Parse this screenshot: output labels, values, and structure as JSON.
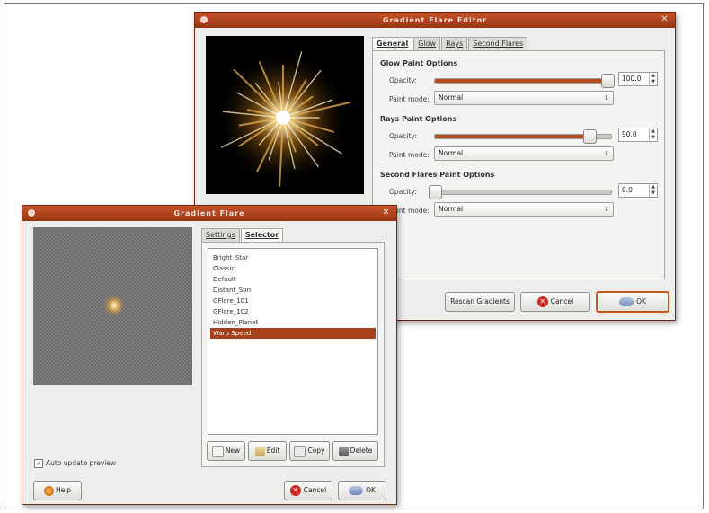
{
  "editor": {
    "title": "Gradient Flare Editor",
    "tabs": [
      "General",
      "Glow",
      "Rays",
      "Second Flares"
    ],
    "glow_section": "Glow Paint Options",
    "rays_section": "Rays Paint Options",
    "second_section": "Second Flares Paint Options",
    "opacity_label": "Opacity:",
    "paint_mode_label": "Paint mode:",
    "glow_opacity": "100.0",
    "rays_opacity": "90.0",
    "second_opacity": "0.0",
    "glow_opacity_fraction": 0.98,
    "rays_opacity_fraction": 0.88,
    "second_opacity_fraction": 0.0,
    "glow_mode": "Normal",
    "rays_mode": "Normal",
    "second_mode": "Normal",
    "rescan_button": "Rescan Gradients",
    "cancel_button": "Cancel",
    "ok_button": "OK"
  },
  "flare": {
    "title": "Gradient Flare",
    "tabs": [
      "Settings",
      "Selector"
    ],
    "items": [
      "Bright_Star",
      "Classic",
      "Default",
      "Distant_Sun",
      "GFlare_101",
      "GFlare_102",
      "Hidden_Planet",
      "Warp Speed"
    ],
    "selected_index": 7,
    "new_button": "New",
    "edit_button": "Edit",
    "copy_button": "Copy",
    "delete_button": "Delete",
    "auto_update_label": "Auto update preview",
    "auto_update_checked": true,
    "help_button": "Help",
    "cancel_button": "Cancel",
    "ok_button": "OK"
  }
}
